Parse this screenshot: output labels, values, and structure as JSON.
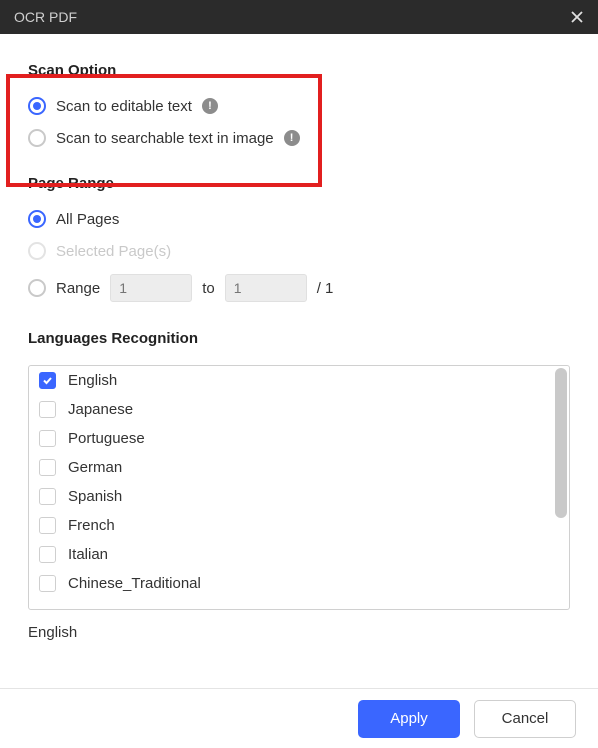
{
  "title": "OCR PDF",
  "scanOption": {
    "heading": "Scan Option",
    "options": {
      "editable": "Scan to editable text",
      "searchable": "Scan to searchable text in image"
    }
  },
  "pageRange": {
    "heading": "Page Range",
    "allPages": "All Pages",
    "selectedPages": "Selected Page(s)",
    "rangeLabel": "Range",
    "from": "1",
    "to": "1",
    "toLabel": "to",
    "total": "/ 1"
  },
  "languages": {
    "heading": "Languages Recognition",
    "items": {
      "0": "English",
      "1": "Japanese",
      "2": "Portuguese",
      "3": "German",
      "4": "Spanish",
      "5": "French",
      "6": "Italian",
      "7": "Chinese_Traditional"
    },
    "selected": "English"
  },
  "footer": {
    "apply": "Apply",
    "cancel": "Cancel"
  }
}
